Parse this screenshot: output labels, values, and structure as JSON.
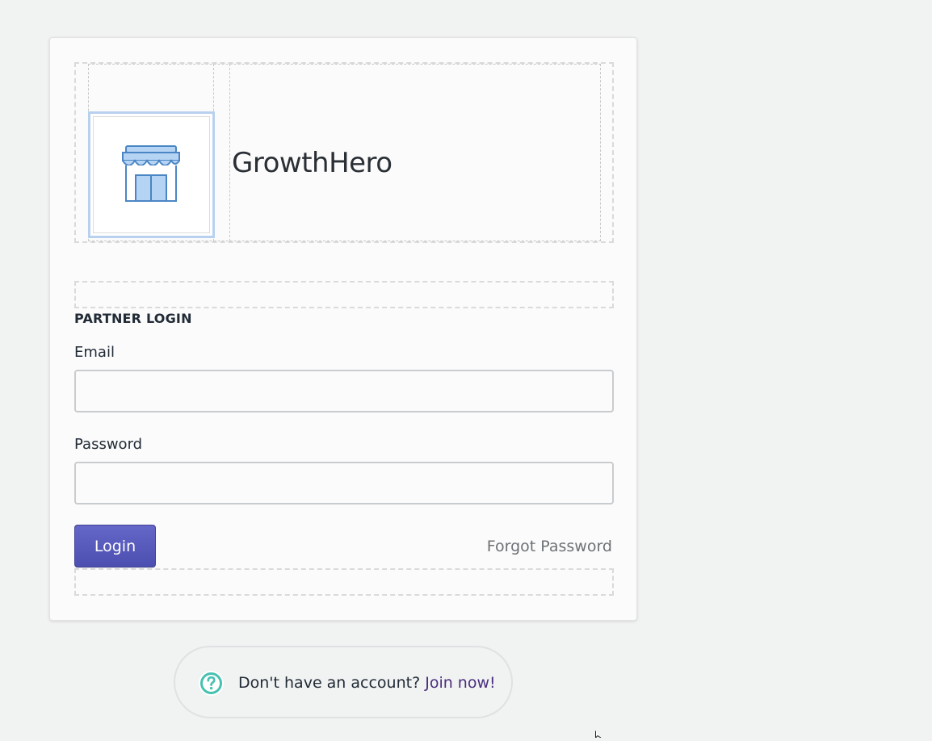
{
  "brand": {
    "name": "GrowthHero",
    "logo_icon": "storefront-icon"
  },
  "login": {
    "section_title": "PARTNER LOGIN",
    "email_label": "Email",
    "email_value": "",
    "password_label": "Password",
    "password_value": "",
    "login_button": "Login",
    "forgot_password": "Forgot Password"
  },
  "signup": {
    "icon": "help-circle-icon",
    "prompt": "Don't have an account?",
    "link": "Join now!"
  },
  "colors": {
    "page_background": "#f1f2f2",
    "primary_button": "#5c5fc4",
    "link": "#4a2e7d",
    "help_icon": "#47c1b0"
  }
}
